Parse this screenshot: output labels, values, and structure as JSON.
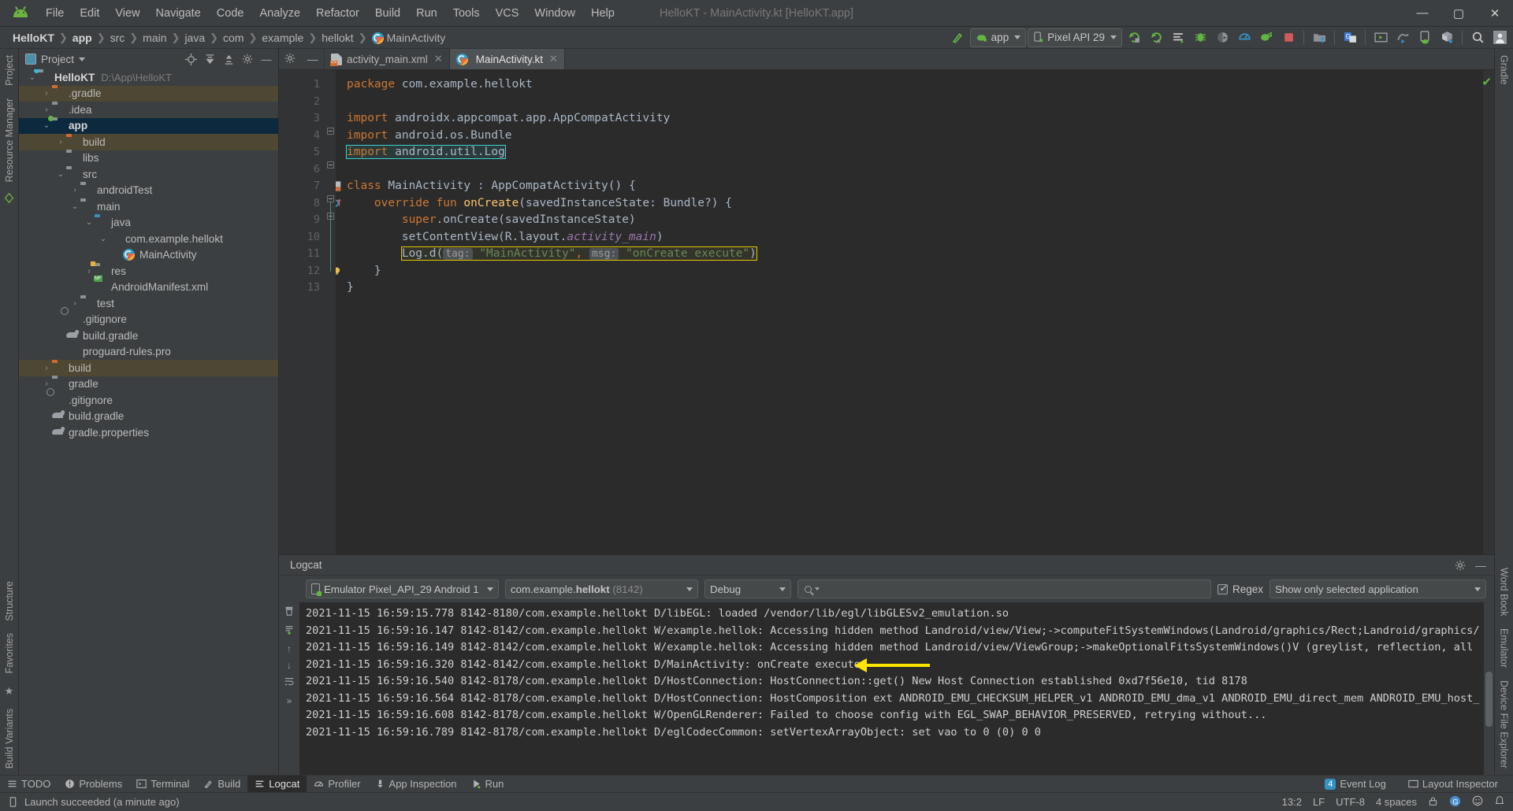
{
  "window": {
    "title": "HelloKT - MainActivity.kt [HelloKT.app]",
    "minimize": "—",
    "maximize": "▢",
    "close": "✕",
    "logo_name": "android-logo"
  },
  "menu": [
    "File",
    "Edit",
    "View",
    "Navigate",
    "Code",
    "Analyze",
    "Refactor",
    "Build",
    "Run",
    "Tools",
    "VCS",
    "Window",
    "Help"
  ],
  "breadcrumb": {
    "items": [
      "HelloKT",
      "app",
      "src",
      "main",
      "java",
      "com",
      "example",
      "hellokt",
      "MainActivity"
    ],
    "separator": "❯"
  },
  "toolbar": {
    "module_combo": "app",
    "device_combo": "Pixel API 29",
    "icons": [
      {
        "name": "hammer-build-icon",
        "glyph": "🔨"
      },
      {
        "name": "run-icon",
        "glyph": "▶"
      },
      {
        "name": "apply-changes-icon",
        "glyph": "↻"
      },
      {
        "name": "apply-code-changes-icon",
        "glyph": "↻"
      },
      {
        "name": "run-with-coverage-icon",
        "glyph": "≣"
      },
      {
        "name": "debug-icon",
        "glyph": "🐞"
      },
      {
        "name": "profile-icon",
        "glyph": "◗"
      },
      {
        "name": "profiler-icon",
        "glyph": "◔"
      },
      {
        "name": "sync-gradle-icon",
        "glyph": "⟳"
      },
      {
        "name": "stop-icon",
        "glyph": "■"
      },
      {
        "name": "avd-manager-icon",
        "glyph": "▤"
      },
      {
        "name": "sdk-manager-icon",
        "glyph": "G"
      },
      {
        "name": "layout-inspector-icon",
        "glyph": "▣"
      },
      {
        "name": "resource-manager-icon",
        "glyph": "✎"
      },
      {
        "name": "device-file-explorer-icon",
        "glyph": "▯"
      },
      {
        "name": "build-variants-icon",
        "glyph": "⬓"
      },
      {
        "name": "search-everywhere-icon",
        "glyph": "🔍"
      },
      {
        "name": "account-icon",
        "glyph": "👤"
      }
    ]
  },
  "project_panel": {
    "title": "Project",
    "actions": [
      "locate-icon",
      "expand-all-icon",
      "collapse-all-icon",
      "settings-icon",
      "hide-icon"
    ],
    "tree": [
      {
        "label": "HelloKT",
        "path": "D:\\App\\HelloKT",
        "depth": 0,
        "arrow": "v",
        "icon": "folder-module",
        "bold": true,
        "state": "normal"
      },
      {
        "label": ".gradle",
        "path": "",
        "depth": 1,
        "arrow": ">",
        "icon": "folder-orange",
        "bold": false,
        "state": "mod"
      },
      {
        "label": ".idea",
        "path": "",
        "depth": 1,
        "arrow": ">",
        "icon": "folder-grey",
        "bold": false,
        "state": "normal"
      },
      {
        "label": "app",
        "path": "",
        "depth": 1,
        "arrow": "v",
        "icon": "folder-module-green",
        "bold": true,
        "state": "sel"
      },
      {
        "label": "build",
        "path": "",
        "depth": 2,
        "arrow": ">",
        "icon": "folder-orange",
        "bold": false,
        "state": "mod"
      },
      {
        "label": "libs",
        "path": "",
        "depth": 2,
        "arrow": "",
        "icon": "folder-grey",
        "bold": false,
        "state": "normal"
      },
      {
        "label": "src",
        "path": "",
        "depth": 2,
        "arrow": "v",
        "icon": "folder-grey",
        "bold": false,
        "state": "normal"
      },
      {
        "label": "androidTest",
        "path": "",
        "depth": 3,
        "arrow": ">",
        "icon": "folder-grey",
        "bold": false,
        "state": "normal"
      },
      {
        "label": "main",
        "path": "",
        "depth": 3,
        "arrow": "v",
        "icon": "folder-grey",
        "bold": false,
        "state": "normal"
      },
      {
        "label": "java",
        "path": "",
        "depth": 4,
        "arrow": "v",
        "icon": "folder-blue",
        "bold": false,
        "state": "normal"
      },
      {
        "label": "com.example.hellokt",
        "path": "",
        "depth": 5,
        "arrow": "v",
        "icon": "package",
        "bold": false,
        "state": "normal"
      },
      {
        "label": "MainActivity",
        "path": "",
        "depth": 6,
        "arrow": "",
        "icon": "kotlin-class",
        "bold": false,
        "state": "normal"
      },
      {
        "label": "res",
        "path": "",
        "depth": 4,
        "arrow": ">",
        "icon": "folder-res",
        "bold": false,
        "state": "normal"
      },
      {
        "label": "AndroidManifest.xml",
        "path": "",
        "depth": 4,
        "arrow": "",
        "icon": "manifest",
        "bold": false,
        "state": "normal"
      },
      {
        "label": "test",
        "path": "",
        "depth": 3,
        "arrow": ">",
        "icon": "folder-grey",
        "bold": false,
        "state": "normal"
      },
      {
        "label": ".gitignore",
        "path": "",
        "depth": 2,
        "arrow": "",
        "icon": "gitignore",
        "bold": false,
        "state": "normal"
      },
      {
        "label": "build.gradle",
        "path": "",
        "depth": 2,
        "arrow": "",
        "icon": "gradle",
        "bold": false,
        "state": "normal"
      },
      {
        "label": "proguard-rules.pro",
        "path": "",
        "depth": 2,
        "arrow": "",
        "icon": "file",
        "bold": false,
        "state": "normal"
      },
      {
        "label": "build",
        "path": "",
        "depth": 1,
        "arrow": ">",
        "icon": "folder-orange",
        "bold": false,
        "state": "mod"
      },
      {
        "label": "gradle",
        "path": "",
        "depth": 1,
        "arrow": ">",
        "icon": "folder-grey",
        "bold": false,
        "state": "normal"
      },
      {
        "label": ".gitignore",
        "path": "",
        "depth": 1,
        "arrow": "",
        "icon": "gitignore",
        "bold": false,
        "state": "normal"
      },
      {
        "label": "build.gradle",
        "path": "",
        "depth": 1,
        "arrow": "",
        "icon": "gradle",
        "bold": false,
        "state": "normal"
      },
      {
        "label": "gradle.properties",
        "path": "",
        "depth": 1,
        "arrow": "",
        "icon": "gradle",
        "bold": false,
        "state": "normal"
      }
    ]
  },
  "left_strip": [
    "Project",
    "Resource Manager"
  ],
  "left_strip_bottom": [
    "Structure",
    "Favorites",
    "Build Variants"
  ],
  "right_strip": [
    "Gradle",
    "Word Book",
    "Emulator",
    "Device File Explorer"
  ],
  "editor": {
    "tabs": [
      {
        "label": "activity_main.xml",
        "icon": "xml-layout-icon",
        "active": false,
        "close": "✕"
      },
      {
        "label": "MainActivity.kt",
        "icon": "kotlin-file-icon",
        "active": true,
        "close": "✕"
      }
    ],
    "line_numbers": [
      "1",
      "2",
      "3",
      "4",
      "5",
      "6",
      "7",
      "8",
      "9",
      "10",
      "11",
      "12",
      "13"
    ],
    "lines": [
      {
        "n": 1,
        "html": "<span class=\"kw\">package</span> com.example.hellokt"
      },
      {
        "n": 2,
        "html": ""
      },
      {
        "n": 3,
        "html": "<span class=\"kw\">import</span> androidx.appcompat.app.AppCompatActivity"
      },
      {
        "n": 4,
        "html": "<span class=\"kw\">import</span> android.os.Bundle"
      },
      {
        "n": 5,
        "html": "<span class=\"kw\">import</span> android.util.Log"
      },
      {
        "n": 6,
        "html": ""
      },
      {
        "n": 7,
        "html": "<span class=\"kw\">class</span> <span class=\"id\">MainActivity</span> : AppCompatActivity() {"
      },
      {
        "n": 8,
        "html": "    <span class=\"kw\">override fun</span> <span class=\"fn\">onCreate</span>(savedInstanceState: Bundle?) {"
      },
      {
        "n": 9,
        "html": "        <span class=\"kw\">super</span>.onCreate(savedInstanceState)"
      },
      {
        "n": 10,
        "html": "        setContentView(R.layout.<span class=\"prop\">activity_main</span>)"
      },
      {
        "n": 11,
        "html": "        Log.d( tag: \"MainActivity\", msg: \"onCreate execute\")"
      },
      {
        "n": 12,
        "html": "    }"
      },
      {
        "n": 13,
        "html": "}"
      }
    ],
    "log_line": {
      "call": "Log.d(",
      "tag_hint": "tag:",
      "tag_value": "\"MainActivity\"",
      "comma": ",",
      "msg_hint": "msg:",
      "msg_value": "\"onCreate execute\"",
      "close": ")"
    },
    "inspection_status": "✔"
  },
  "logcat": {
    "title": "Logcat",
    "device": "Emulator Pixel_API_29 Android 1",
    "process_prefix": "com.example.",
    "process_bold": "hellokt",
    "process_pid": "(8142)",
    "level": "Debug",
    "search_placeholder": "",
    "search_icon_label": "Q",
    "regex_label": "Regex",
    "scope": "Show only selected application",
    "lines": [
      "2021-11-15 16:59:15.778 8142-8180/com.example.hellokt D/libEGL: loaded /vendor/lib/egl/libGLESv2_emulation.so",
      "2021-11-15 16:59:16.147 8142-8142/com.example.hellokt W/example.hellok: Accessing hidden method Landroid/view/View;->computeFitSystemWindows(Landroid/graphics/Rect;Landroid/graphics/",
      "2021-11-15 16:59:16.149 8142-8142/com.example.hellokt W/example.hellok: Accessing hidden method Landroid/view/ViewGroup;->makeOptionalFitsSystemWindows()V (greylist, reflection, all",
      "2021-11-15 16:59:16.320 8142-8142/com.example.hellokt D/MainActivity: onCreate execute",
      "2021-11-15 16:59:16.540 8142-8178/com.example.hellokt D/HostConnection: HostConnection::get() New Host Connection established 0xd7f56e10, tid 8178",
      "2021-11-15 16:59:16.564 8142-8178/com.example.hellokt D/HostConnection: HostComposition ext ANDROID_EMU_CHECKSUM_HELPER_v1 ANDROID_EMU_dma_v1 ANDROID_EMU_direct_mem ANDROID_EMU_host_",
      "2021-11-15 16:59:16.608 8142-8178/com.example.hellokt W/OpenGLRenderer: Failed to choose config with EGL_SWAP_BEHAVIOR_PRESERVED, retrying without...",
      "2021-11-15 16:59:16.789 8142-8178/com.example.hellokt D/eglCodecCommon: setVertexArrayObject: set vao to 0 (0) 0 0"
    ],
    "highlight_line_index": 3,
    "side_icons": [
      "clear-logcat-icon",
      "scroll-to-end-icon",
      "up-arrow-icon",
      "down-arrow-icon",
      "soft-wrap-icon",
      "more-icon"
    ]
  },
  "bottom_bar": {
    "items": [
      {
        "label": "TODO",
        "icon": "todo-icon",
        "active": false
      },
      {
        "label": "Problems",
        "icon": "problems-icon",
        "active": false
      },
      {
        "label": "Terminal",
        "icon": "terminal-icon",
        "active": false
      },
      {
        "label": "Build",
        "icon": "build-hammer-icon",
        "active": false
      },
      {
        "label": "Logcat",
        "icon": "logcat-icon",
        "active": true
      },
      {
        "label": "Profiler",
        "icon": "profiler-icon",
        "active": false
      },
      {
        "label": "App Inspection",
        "icon": "app-inspection-icon",
        "active": false
      },
      {
        "label": "Run",
        "icon": "run-play-icon",
        "active": false
      }
    ],
    "event_log": {
      "label": "Event Log",
      "count": "4"
    },
    "layout_inspector": "Layout Inspector"
  },
  "status_bar": {
    "message": "Launch succeeded (a minute ago)",
    "caret": "13:2",
    "line_sep": "LF",
    "encoding": "UTF-8",
    "indent": "4 spaces",
    "icons": [
      "lock-icon",
      "google-icon",
      "smiley-icon",
      "notification-icon"
    ]
  },
  "colors": {
    "accent_green": "#62b543",
    "accent_blue": "#3592c4",
    "selection": "#0d293e",
    "modified": "#4e4733",
    "editor_bg": "#2b2b2b",
    "panel_bg": "#3c3f41",
    "highlight_yellow": "#e5c700",
    "arrow_yellow": "#ffe400",
    "import_cyan": "#3dd1d1"
  }
}
